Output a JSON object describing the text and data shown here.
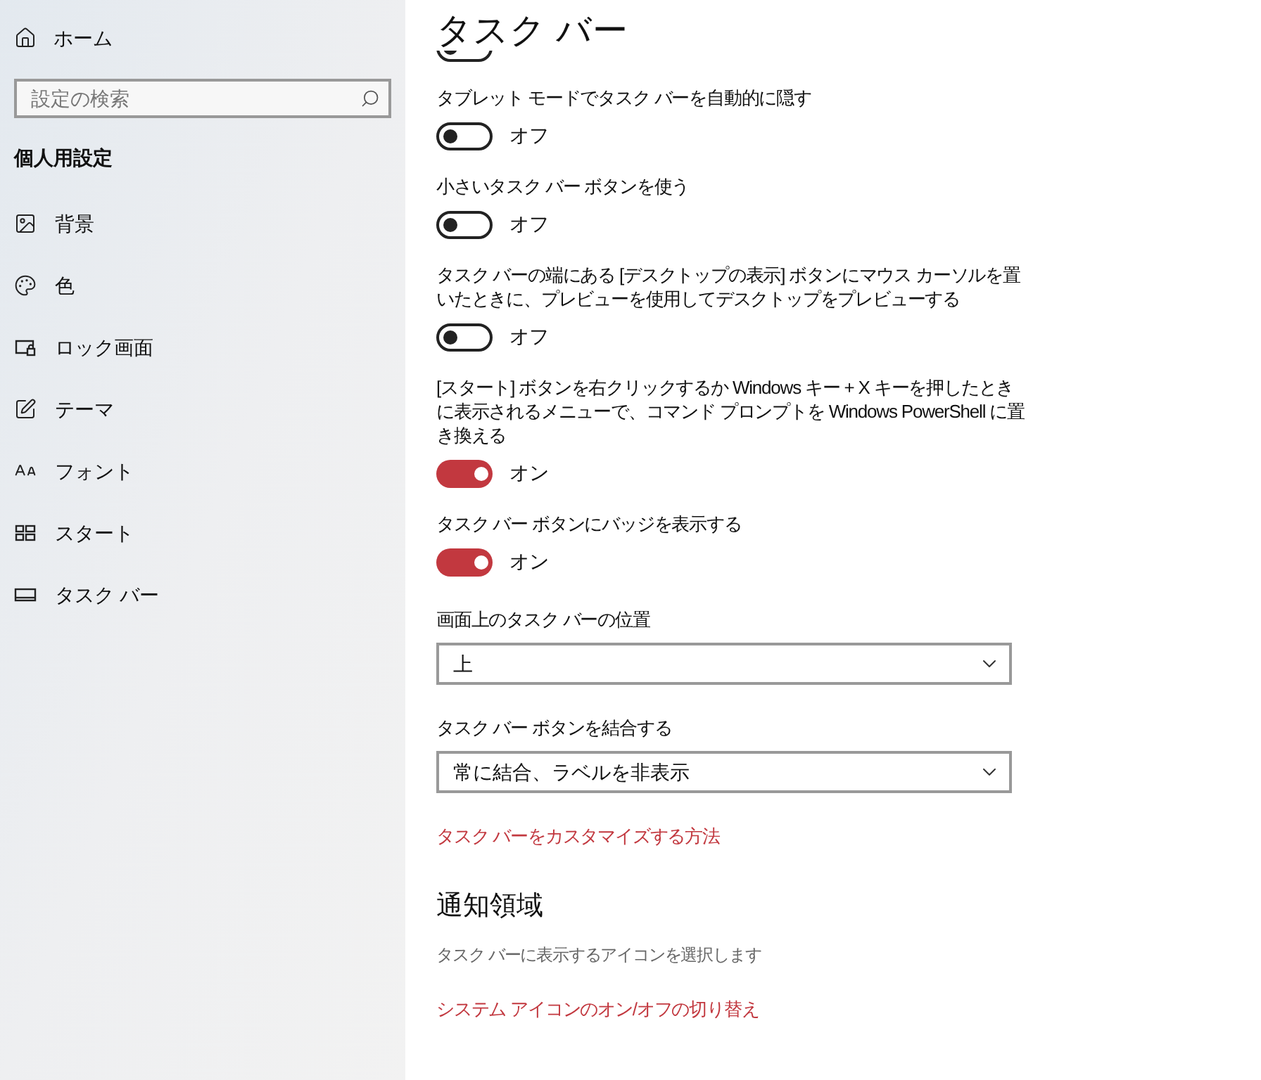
{
  "sidebar": {
    "home": "ホーム",
    "search": {
      "placeholder": "設定の検索"
    },
    "section": "個人用設定",
    "items": [
      {
        "label": "背景",
        "kind": "image"
      },
      {
        "label": "色",
        "kind": "palette"
      },
      {
        "label": "ロック画面",
        "kind": "lock"
      },
      {
        "label": "テーマ",
        "kind": "theme"
      },
      {
        "label": "フォント",
        "kind": "font"
      },
      {
        "label": "スタート",
        "kind": "start"
      },
      {
        "label": "タスク バー",
        "kind": "taskbar"
      }
    ]
  },
  "page": {
    "title": "タスク バー",
    "settings": [
      {
        "kind": "toggle",
        "on": false
      },
      {
        "kind": "toggle",
        "label": "タブレット モードでタスク バーを自動的に隠す",
        "on": false,
        "state_text": "オフ"
      },
      {
        "kind": "toggle",
        "label": "小さいタスク バー ボタンを使う",
        "on": false,
        "state_text": "オフ"
      },
      {
        "kind": "toggle",
        "label": "タスク バーの端にある [デスクトップの表示] ボタンにマウス カーソルを置いたときに、プレビューを使用してデスクトップをプレビューする",
        "on": false,
        "state_text": "オフ"
      },
      {
        "kind": "toggle",
        "label": "[スタート] ボタンを右クリックするか Windows キー + X キーを押したときに表示されるメニューで、コマンド プロンプトを Windows PowerShell に置き換える",
        "on": true,
        "state_text": "オン"
      },
      {
        "kind": "toggle",
        "label": "タスク バー ボタンにバッジを表示する",
        "on": true,
        "state_text": "オン"
      },
      {
        "kind": "dropdown",
        "label": "画面上のタスク バーの位置",
        "value": "上"
      },
      {
        "kind": "dropdown",
        "label": "タスク バー ボタンを結合する",
        "value": "常に結合、ラベルを非表示"
      },
      {
        "kind": "link",
        "text": "タスク バーをカスタマイズする方法"
      },
      {
        "kind": "heading",
        "text": "通知領域"
      },
      {
        "kind": "text",
        "text": "タスク バーに表示するアイコンを選択します"
      },
      {
        "kind": "link",
        "text": "システム アイコンのオン/オフの切り替え"
      }
    ]
  }
}
